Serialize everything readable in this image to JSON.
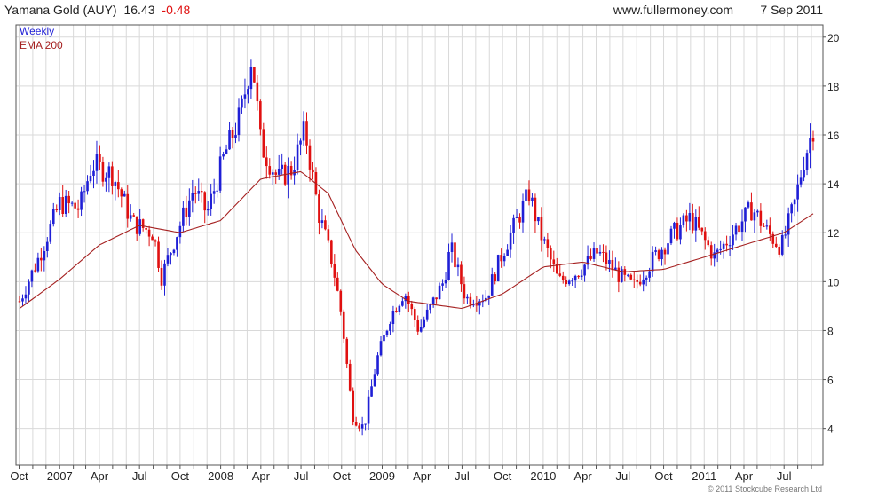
{
  "header": {
    "name": "Yamana Gold (AUY)",
    "last": "16.43",
    "change": "-0.48",
    "site": "www.fullermoney.com",
    "date": "7 Sep 2011"
  },
  "footer": {
    "copyright": "© 2011 Stockcube Research Ltd"
  },
  "colors": {
    "up": "#1f1fd6",
    "down": "#e01010",
    "ema": "#a52020",
    "grid": "#d9d9d9",
    "frame": "#555555"
  },
  "chart_data": {
    "type": "candlestick",
    "period": "Weekly",
    "legend": [
      {
        "label": "Weekly",
        "color": "#1f1fd6"
      },
      {
        "label": "EMA 200",
        "color": "#a52020"
      }
    ],
    "y_axis": {
      "position": "right",
      "ylim": [
        2.5,
        20.5
      ],
      "ticks": [
        4,
        6,
        8,
        10,
        12,
        14,
        16,
        18,
        20
      ]
    },
    "x_axis": {
      "start": "2006-10-02",
      "end": "2011-09-07",
      "tick_labels": [
        "Oct",
        "2007",
        "Apr",
        "Jul",
        "Oct",
        "2008",
        "Apr",
        "Jul",
        "Oct",
        "2009",
        "Apr",
        "Jul",
        "Oct",
        "2010",
        "Apr",
        "Jul",
        "Oct",
        "2011",
        "Apr",
        "Jul"
      ]
    },
    "grid": true,
    "price_path": [
      [
        "2006-10-02",
        9.2
      ],
      [
        "2006-11-15",
        11.0
      ],
      [
        "2007-01-01",
        13.2
      ],
      [
        "2007-02-15",
        13.0
      ],
      [
        "2007-03-15",
        14.8
      ],
      [
        "2007-05-01",
        14.4
      ],
      [
        "2007-06-15",
        12.4
      ],
      [
        "2007-08-01",
        12.0
      ],
      [
        "2007-08-20",
        10.2
      ],
      [
        "2007-09-20",
        11.8
      ],
      [
        "2007-11-01",
        13.8
      ],
      [
        "2007-12-01",
        12.8
      ],
      [
        "2008-01-10",
        15.2
      ],
      [
        "2008-02-15",
        16.8
      ],
      [
        "2008-03-12",
        19.3
      ],
      [
        "2008-04-01",
        15.6
      ],
      [
        "2008-05-10",
        14.2
      ],
      [
        "2008-06-10",
        14.6
      ],
      [
        "2008-07-10",
        16.2
      ],
      [
        "2008-08-10",
        12.8
      ],
      [
        "2008-09-10",
        10.8
      ],
      [
        "2008-10-01",
        8.6
      ],
      [
        "2008-10-25",
        4.6
      ],
      [
        "2008-11-20",
        4.0
      ],
      [
        "2008-12-20",
        6.8
      ],
      [
        "2009-01-20",
        8.6
      ],
      [
        "2009-02-20",
        9.6
      ],
      [
        "2009-03-25",
        8.0
      ],
      [
        "2009-05-20",
        10.0
      ],
      [
        "2009-06-05",
        11.4
      ],
      [
        "2009-07-10",
        9.3
      ],
      [
        "2009-08-25",
        9.4
      ],
      [
        "2009-10-01",
        11.2
      ],
      [
        "2009-11-30",
        13.6
      ],
      [
        "2009-12-25",
        12.0
      ],
      [
        "2010-02-05",
        10.0
      ],
      [
        "2010-03-20",
        10.4
      ],
      [
        "2010-05-05",
        11.2
      ],
      [
        "2010-06-25",
        10.2
      ],
      [
        "2010-07-25",
        9.8
      ],
      [
        "2010-09-10",
        11.0
      ],
      [
        "2010-10-25",
        12.0
      ],
      [
        "2010-12-01",
        12.6
      ],
      [
        "2011-01-25",
        11.0
      ],
      [
        "2011-03-15",
        12.2
      ],
      [
        "2011-04-20",
        13.0
      ],
      [
        "2011-05-25",
        12.0
      ],
      [
        "2011-06-25",
        11.4
      ],
      [
        "2011-07-25",
        13.2
      ],
      [
        "2011-08-15",
        15.0
      ],
      [
        "2011-09-07",
        16.43
      ]
    ],
    "ema200_path": [
      [
        "2006-10-02",
        8.9
      ],
      [
        "2007-01-01",
        10.1
      ],
      [
        "2007-04-01",
        11.5
      ],
      [
        "2007-07-01",
        12.3
      ],
      [
        "2007-10-01",
        12.0
      ],
      [
        "2008-01-01",
        12.5
      ],
      [
        "2008-04-01",
        14.2
      ],
      [
        "2008-07-01",
        14.5
      ],
      [
        "2008-09-01",
        13.6
      ],
      [
        "2008-11-01",
        11.3
      ],
      [
        "2009-01-01",
        9.9
      ],
      [
        "2009-03-01",
        9.2
      ],
      [
        "2009-07-01",
        8.9
      ],
      [
        "2009-10-01",
        9.5
      ],
      [
        "2010-01-01",
        10.6
      ],
      [
        "2010-04-01",
        10.8
      ],
      [
        "2010-07-01",
        10.4
      ],
      [
        "2010-10-01",
        10.5
      ],
      [
        "2011-01-01",
        11.0
      ],
      [
        "2011-04-01",
        11.5
      ],
      [
        "2011-07-01",
        12.0
      ],
      [
        "2011-09-07",
        12.8
      ]
    ]
  }
}
